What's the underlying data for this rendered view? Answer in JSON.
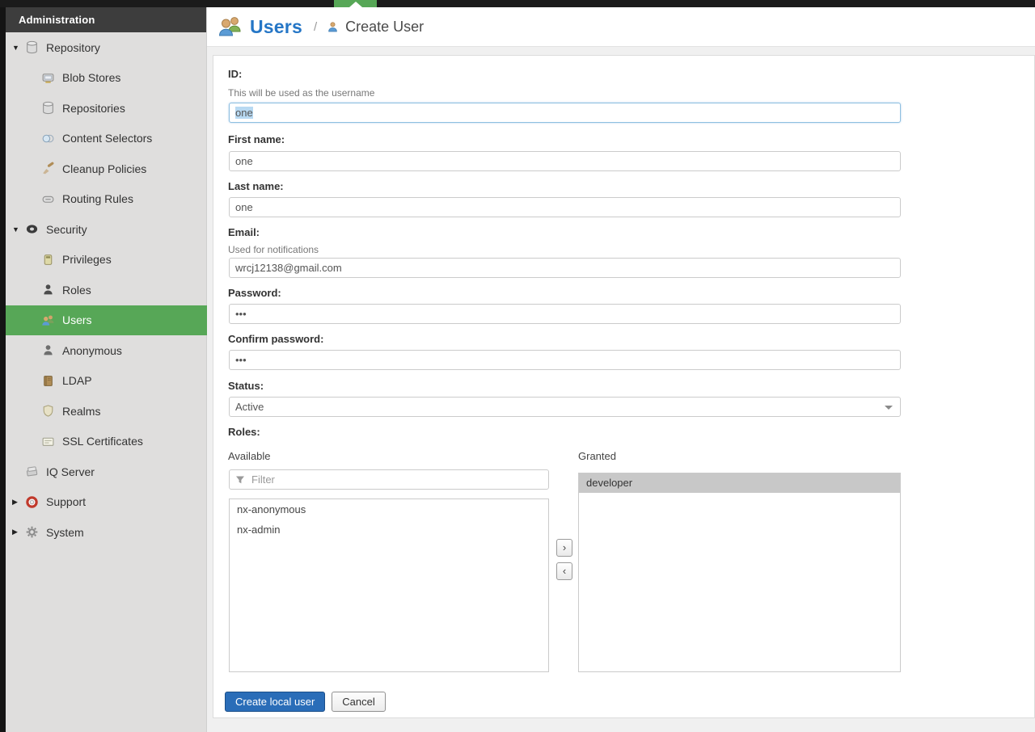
{
  "colors": {
    "accent_green": "#57a757",
    "breadcrumb_blue": "#2576c6",
    "primary_button_blue": "#2a6db8",
    "selection_highlight": "#b8d9f2",
    "granted_highlight": "#c8c8c8"
  },
  "sidebar": {
    "header": "Administration",
    "glyphs": {
      "expanded": "▼",
      "collapsed": "▶"
    },
    "items": [
      {
        "label": "Repository",
        "level": 0,
        "expander": "expanded",
        "icon": "database-icon"
      },
      {
        "label": "Blob Stores",
        "level": 1,
        "icon": "blob-stores-icon"
      },
      {
        "label": "Repositories",
        "level": 1,
        "icon": "repositories-icon"
      },
      {
        "label": "Content Selectors",
        "level": 1,
        "icon": "content-selectors-icon"
      },
      {
        "label": "Cleanup Policies",
        "level": 1,
        "icon": "cleanup-policies-icon"
      },
      {
        "label": "Routing Rules",
        "level": 1,
        "icon": "routing-rules-icon"
      },
      {
        "label": "Security",
        "level": 0,
        "expander": "expanded",
        "icon": "security-badge-icon"
      },
      {
        "label": "Privileges",
        "level": 1,
        "icon": "privileges-icon"
      },
      {
        "label": "Roles",
        "level": 1,
        "icon": "roles-icon"
      },
      {
        "label": "Users",
        "level": 1,
        "icon": "users-icon",
        "selected": true
      },
      {
        "label": "Anonymous",
        "level": 1,
        "icon": "anonymous-icon"
      },
      {
        "label": "LDAP",
        "level": 1,
        "icon": "ldap-icon"
      },
      {
        "label": "Realms",
        "level": 1,
        "icon": "realms-icon"
      },
      {
        "label": "SSL Certificates",
        "level": 1,
        "icon": "ssl-certificates-icon"
      },
      {
        "label": "IQ Server",
        "level": 0,
        "icon": "iq-server-icon"
      },
      {
        "label": "Support",
        "level": 0,
        "expander": "collapsed",
        "icon": "support-icon"
      },
      {
        "label": "System",
        "level": 0,
        "expander": "collapsed",
        "icon": "system-gear-icon"
      }
    ]
  },
  "header": {
    "breadcrumb_root": "Users",
    "separator": "/",
    "breadcrumb_current": "Create User"
  },
  "form": {
    "id": {
      "label": "ID:",
      "help": "This will be used as the username",
      "value": "one"
    },
    "first_name": {
      "label": "First name:",
      "value": "one"
    },
    "last_name": {
      "label": "Last name:",
      "value": "one"
    },
    "email": {
      "label": "Email:",
      "help": "Used for notifications",
      "value": "wrcj12138@gmail.com"
    },
    "password": {
      "label": "Password:",
      "value": "•••"
    },
    "confirm_password": {
      "label": "Confirm password:",
      "value": "•••"
    },
    "status": {
      "label": "Status:",
      "value": "Active"
    },
    "roles": {
      "label": "Roles:",
      "available_label": "Available",
      "granted_label": "Granted",
      "filter_placeholder": "Filter",
      "available": [
        "nx-anonymous",
        "nx-admin"
      ],
      "granted": [
        "developer"
      ],
      "move_right_glyph": "›",
      "move_left_glyph": "‹"
    },
    "buttons": {
      "submit": "Create local user",
      "cancel": "Cancel"
    }
  }
}
